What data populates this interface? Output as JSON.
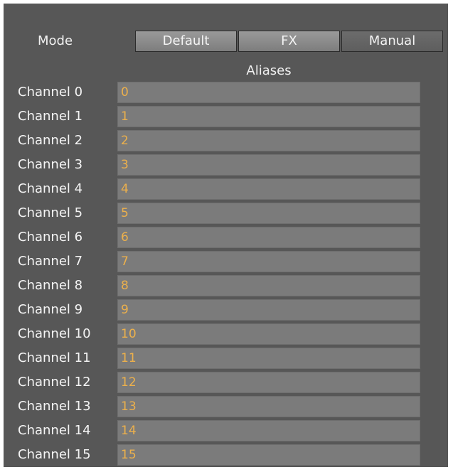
{
  "mode": {
    "label": "Mode",
    "options": [
      "Default",
      "FX",
      "Manual"
    ],
    "selected": "Manual"
  },
  "aliases_header": "Aliases",
  "channels": [
    {
      "label": "Channel 0",
      "alias": "0"
    },
    {
      "label": "Channel 1",
      "alias": "1"
    },
    {
      "label": "Channel 2",
      "alias": "2"
    },
    {
      "label": "Channel 3",
      "alias": "3"
    },
    {
      "label": "Channel 4",
      "alias": "4"
    },
    {
      "label": "Channel 5",
      "alias": "5"
    },
    {
      "label": "Channel 6",
      "alias": "6"
    },
    {
      "label": "Channel 7",
      "alias": "7"
    },
    {
      "label": "Channel 8",
      "alias": "8"
    },
    {
      "label": "Channel 9",
      "alias": "9"
    },
    {
      "label": "Channel 10",
      "alias": "10"
    },
    {
      "label": "Channel 11",
      "alias": "11"
    },
    {
      "label": "Channel 12",
      "alias": "12"
    },
    {
      "label": "Channel 13",
      "alias": "13"
    },
    {
      "label": "Channel 14",
      "alias": "14"
    },
    {
      "label": "Channel 15",
      "alias": "15"
    }
  ],
  "colors": {
    "panel_background": "#575757",
    "field_background": "#7b7b7b",
    "alias_text": "#ecb04c",
    "label_text": "#f4f4f4"
  }
}
